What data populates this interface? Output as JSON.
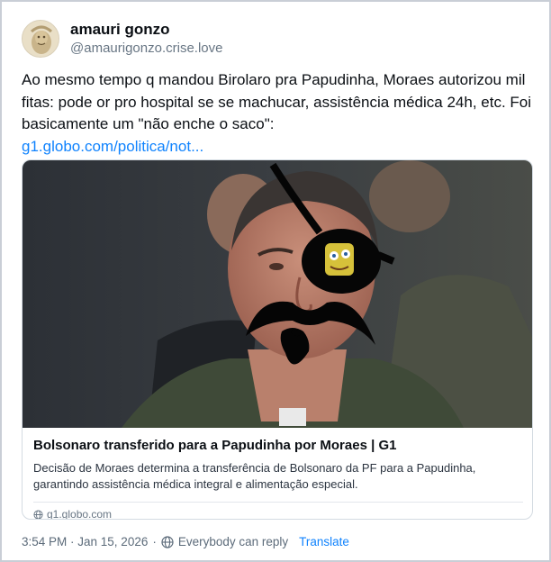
{
  "author": {
    "display_name": "amauri gonzo",
    "handle": "@amaurigonzo.crise.love"
  },
  "post": {
    "text": "Ao mesmo tempo q mandou Birolaro pra Papudinha, Moraes autorizou mil fitas: pode or pro hospital se se machucar, assistência médica 24h, etc. Foi basicamente um \"não enche o saco\":",
    "link_text": "g1.globo.com/politica/not..."
  },
  "link_card": {
    "title": "Bolsonaro transferido para a Papudinha por Moraes | G1",
    "description": "Decisão de Moraes determina a transferência de Bolsonaro da PF para a Papudinha, garantindo assistência médica integral e alimentação especial.",
    "domain": "g1.globo.com",
    "image_icon": "edited-photo-of-man-with-drawn-eyepatch-and-mustache"
  },
  "footer": {
    "timestamp": "3:54 PM · Jan 15, 2026",
    "reply_setting": "Everybody can reply",
    "translate_label": "Translate"
  },
  "colors": {
    "link": "#1083fe",
    "secondary_text": "#687684"
  }
}
